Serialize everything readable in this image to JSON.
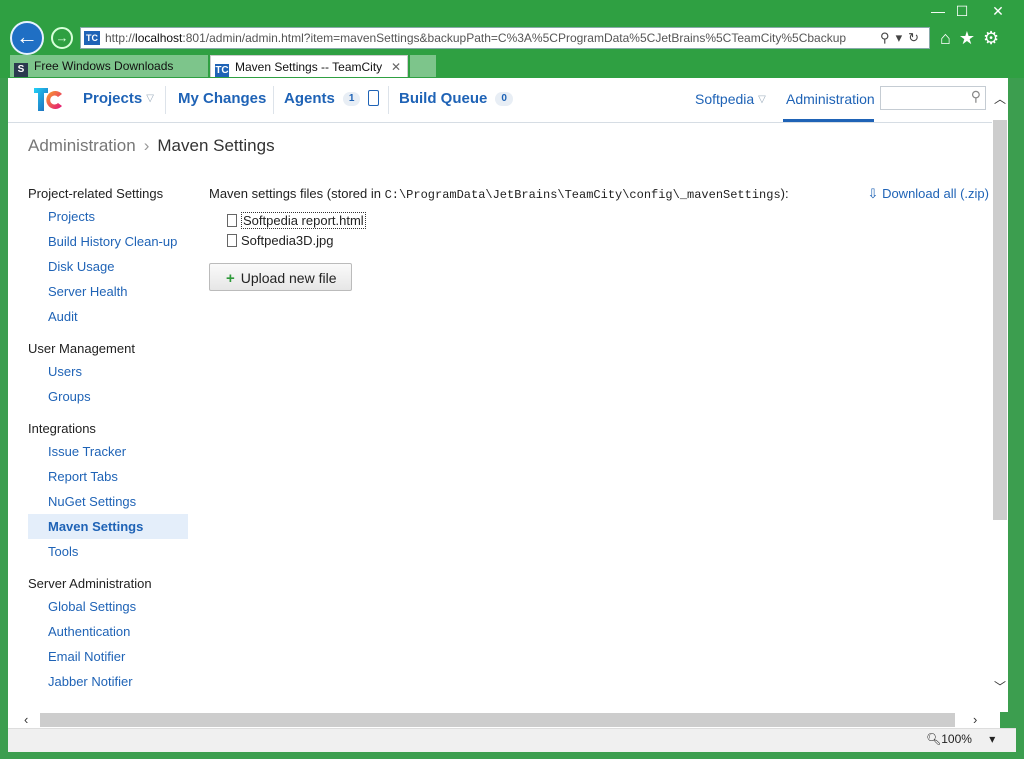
{
  "browser": {
    "address_prefix": "http://",
    "address_host": "localhost",
    "address_rest": ":801/admin/admin.html?item=mavenSettings&backupPath=C%3A%5CProgramData%5CJetBrains%5CTeamCity%5Cbackup",
    "tabs": [
      {
        "label": "Free Windows Downloads",
        "icon": "softpedia-icon",
        "active": false
      },
      {
        "label": "Maven Settings -- TeamCity",
        "icon": "teamcity-icon",
        "active": true
      }
    ],
    "zoom": "100%",
    "colors": {
      "frame": "#2fa042",
      "link": "#1f63b6"
    }
  },
  "topnav": {
    "projects": "Projects",
    "my_changes": "My Changes",
    "agents": "Agents",
    "agents_count": "1",
    "build_queue": "Build Queue",
    "build_queue_count": "0",
    "user": "Softpedia",
    "administration": "Administration"
  },
  "breadcrumb": {
    "root": "Administration",
    "current": "Maven Settings"
  },
  "sidebar": {
    "groups": [
      {
        "title": "Project-related Settings",
        "items": [
          "Projects",
          "Build History Clean-up",
          "Disk Usage",
          "Server Health",
          "Audit"
        ]
      },
      {
        "title": "User Management",
        "items": [
          "Users",
          "Groups"
        ]
      },
      {
        "title": "Integrations",
        "items": [
          "Issue Tracker",
          "Report Tabs",
          "NuGet Settings",
          "Maven Settings",
          "Tools"
        ]
      },
      {
        "title": "Server Administration",
        "items": [
          "Global Settings",
          "Authentication",
          "Email Notifier",
          "Jabber Notifier"
        ]
      }
    ],
    "active_item": "Maven Settings"
  },
  "main": {
    "files_label_prefix": "Maven settings files (stored in ",
    "files_path": "C:\\ProgramData\\JetBrains\\TeamCity\\config\\_mavenSettings",
    "files_label_suffix": "):",
    "download_all": "Download all (.zip)",
    "files": [
      "Softpedia report.html",
      "Softpedia3D.jpg"
    ],
    "upload_button": "Upload new file"
  }
}
